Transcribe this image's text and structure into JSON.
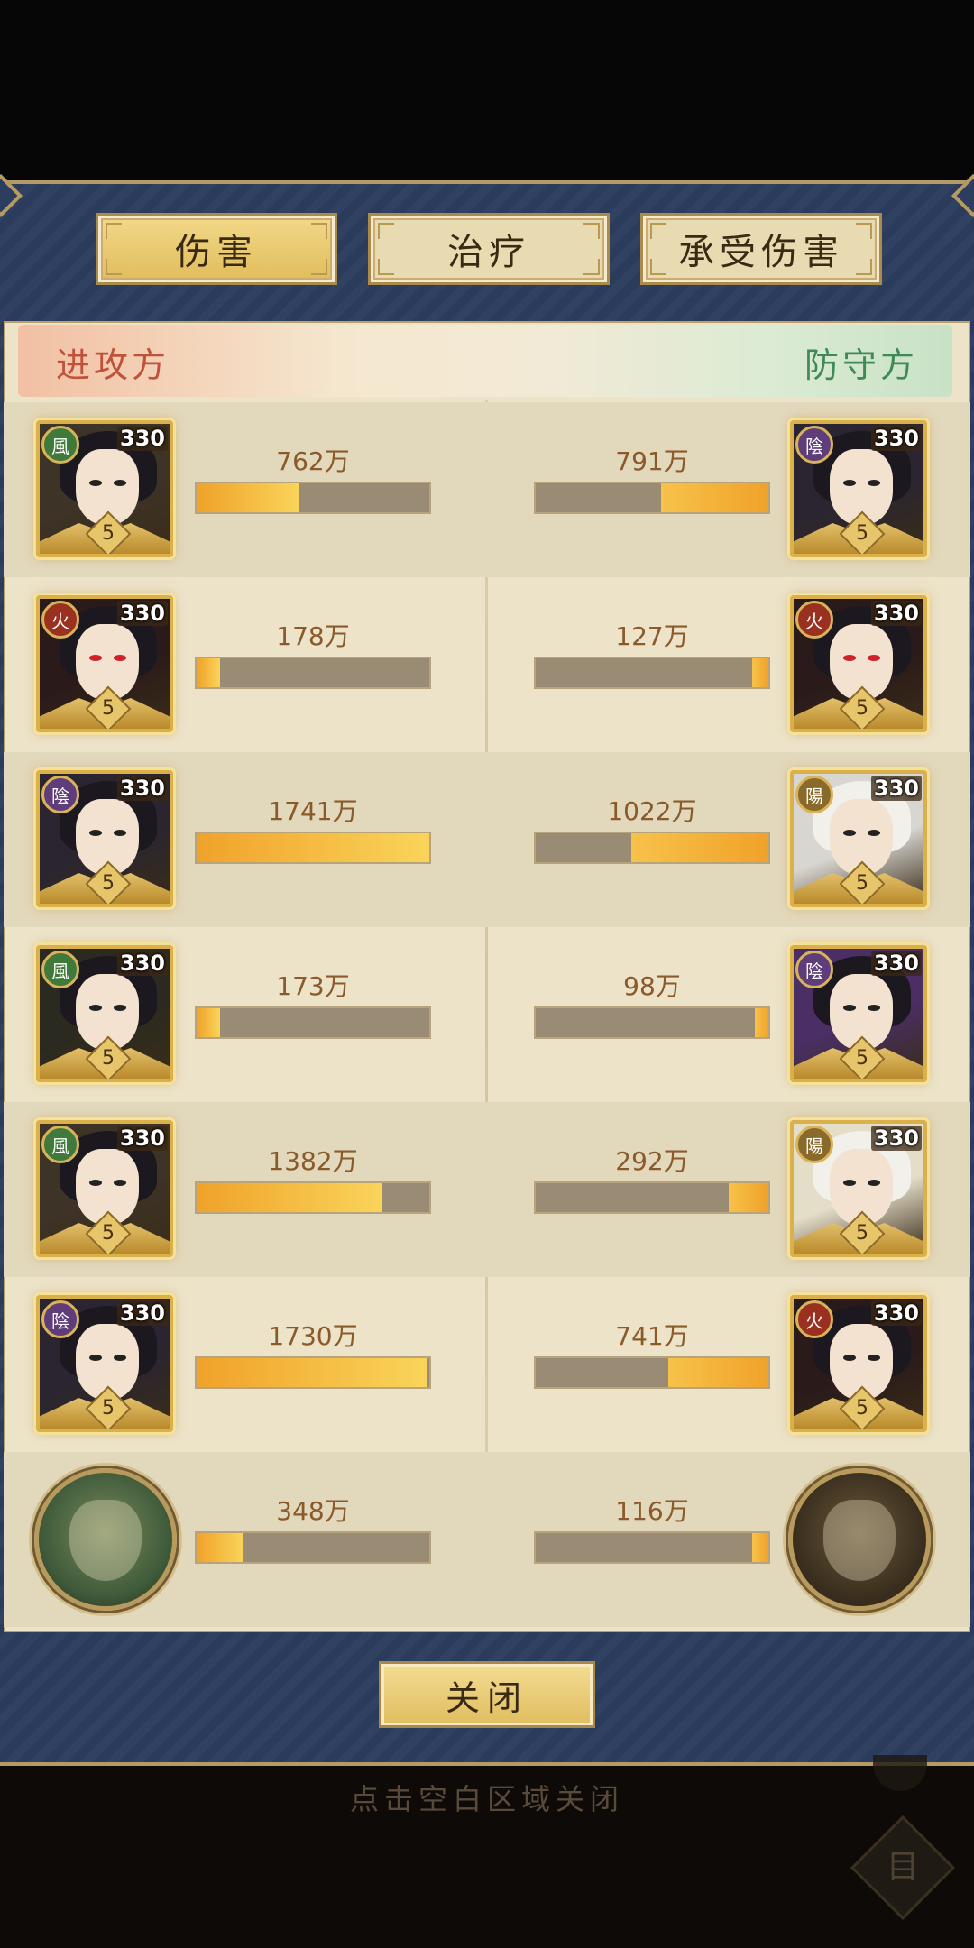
{
  "tabs": [
    {
      "label": "伤害",
      "active": true
    },
    {
      "label": "治疗",
      "active": false
    },
    {
      "label": "承受伤害",
      "active": false
    }
  ],
  "sides": {
    "attacker": "进攻方",
    "defender": "防守方"
  },
  "rows": [
    {
      "left": {
        "value": "762万",
        "fraction": 0.44,
        "element": "風",
        "level": "330",
        "stars": "5",
        "palette": [
          "#3d3326",
          "#5a4a2e"
        ],
        "elem_color": "#3f7a3a"
      },
      "right": {
        "value": "791万",
        "fraction": 0.46,
        "element": "陰",
        "level": "330",
        "stars": "5",
        "palette": [
          "#2a2530",
          "#eeeef2"
        ],
        "elem_color": "#5e3d7a"
      }
    },
    {
      "left": {
        "value": "178万",
        "fraction": 0.1,
        "element": "火",
        "level": "330",
        "stars": "5",
        "palette": [
          "#2a1a1a",
          "#c42a2a"
        ],
        "elem_color": "#9a3020",
        "red_eyes": true
      },
      "right": {
        "value": "127万",
        "fraction": 0.07,
        "element": "火",
        "level": "330",
        "stars": "5",
        "palette": [
          "#2a1a1a",
          "#c42a2a"
        ],
        "elem_color": "#9a3020",
        "red_eyes": true
      }
    },
    {
      "left": {
        "value": "1741万",
        "fraction": 1.0,
        "element": "陰",
        "level": "330",
        "stars": "5",
        "palette": [
          "#2a2530",
          "#eeeef2"
        ],
        "elem_color": "#5e3d7a"
      },
      "right": {
        "value": "1022万",
        "fraction": 0.59,
        "element": "陽",
        "level": "330",
        "stars": "5",
        "palette": [
          "#d8d6d0",
          "#b2aca0"
        ],
        "elem_color": "#8a6a2a"
      }
    },
    {
      "left": {
        "value": "173万",
        "fraction": 0.1,
        "element": "風",
        "level": "330",
        "stars": "5",
        "palette": [
          "#2b2a20",
          "#e0d8b8"
        ],
        "elem_color": "#3f7a3a"
      },
      "right": {
        "value": "98万",
        "fraction": 0.06,
        "element": "陰",
        "level": "330",
        "stars": "5",
        "palette": [
          "#4a2e64",
          "#d8c6e4"
        ],
        "elem_color": "#5e3d7a"
      }
    },
    {
      "left": {
        "value": "1382万",
        "fraction": 0.8,
        "element": "風",
        "level": "330",
        "stars": "5",
        "palette": [
          "#3d3326",
          "#5a4a2e"
        ],
        "elem_color": "#3f7a3a"
      },
      "right": {
        "value": "292万",
        "fraction": 0.17,
        "element": "陽",
        "level": "330",
        "stars": "5",
        "palette": [
          "#e4ddc8",
          "#b8ac90"
        ],
        "elem_color": "#8a6a2a"
      }
    },
    {
      "left": {
        "value": "1730万",
        "fraction": 0.99,
        "element": "陰",
        "level": "330",
        "stars": "5",
        "palette": [
          "#2a2530",
          "#eeeef2"
        ],
        "elem_color": "#5e3d7a"
      },
      "right": {
        "value": "741万",
        "fraction": 0.43,
        "element": "火",
        "level": "330",
        "stars": "5",
        "palette": [
          "#2a1a1a",
          "#8a1a1a"
        ],
        "elem_color": "#9a3020"
      }
    },
    {
      "left": {
        "value": "348万",
        "fraction": 0.2,
        "boss": true,
        "palette": [
          "#7a8a5a",
          "#3e5a3a"
        ]
      },
      "right": {
        "value": "116万",
        "fraction": 0.07,
        "boss": true,
        "palette": [
          "#6a5a3a",
          "#3a2e1e"
        ]
      }
    }
  ],
  "close_button": "关闭",
  "hint": "点击空白区域关闭",
  "corner_icon_glyph": "目",
  "colors": {
    "bar_fill": "#f0a22a",
    "bar_track": "#9a8c74",
    "panel": "#2c3d5f",
    "content_bg": "#ece3c9"
  }
}
